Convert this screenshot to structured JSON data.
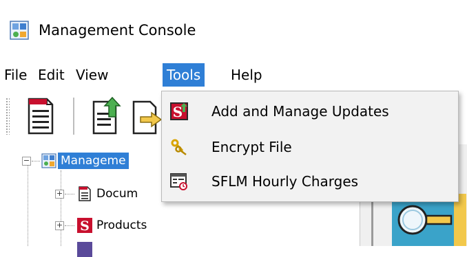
{
  "window": {
    "title": "Management Console",
    "icon": "management-console-icon"
  },
  "menu": {
    "items": [
      {
        "label": "File"
      },
      {
        "label": "Edit"
      },
      {
        "label": "View"
      },
      {
        "label": "Tools",
        "active": true
      },
      {
        "label": "Help"
      }
    ],
    "active_color": "#2f7fd6"
  },
  "toolbar": {
    "buttons": [
      {
        "icon": "document-list-icon"
      },
      {
        "icon": "document-update-icon"
      },
      {
        "icon": "document-export-icon"
      }
    ]
  },
  "tree": {
    "root": {
      "label": "Manageme",
      "icon": "management-console-icon",
      "selected": true
    },
    "children": [
      {
        "label": "Docum",
        "icon": "document-icon"
      },
      {
        "label": "Products",
        "icon": "products-s-icon"
      }
    ]
  },
  "tools_menu": {
    "items": [
      {
        "label": "Add and Manage Updates",
        "icon": "updates-s-icon"
      },
      {
        "label": "Encrypt File",
        "icon": "keys-icon"
      },
      {
        "label": "SFLM Hourly Charges",
        "icon": "hourly-charges-icon"
      }
    ]
  },
  "right_pane": {
    "icon": "key-magnifier-icon"
  }
}
